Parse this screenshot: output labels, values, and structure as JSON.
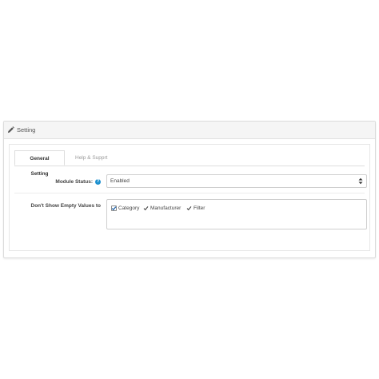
{
  "panel": {
    "title": "Setting",
    "title_icon": "pencil-icon"
  },
  "tabs": [
    {
      "label": "General Setting",
      "active": true
    },
    {
      "label": "Help & Supprt",
      "active": false
    }
  ],
  "module_status": {
    "label": "Module Status:",
    "help_icon": "question-circle-icon",
    "selected": "Enabled"
  },
  "empty_values": {
    "label": "Don't Show Empty Values to",
    "options": [
      {
        "label": "Category",
        "checked": true
      },
      {
        "label": "Manufacturer",
        "checked": true
      },
      {
        "label": "Filter",
        "checked": true
      }
    ]
  },
  "colors": {
    "help_icon": "#1e91cf",
    "heading_bg": "#f5f5f5"
  }
}
